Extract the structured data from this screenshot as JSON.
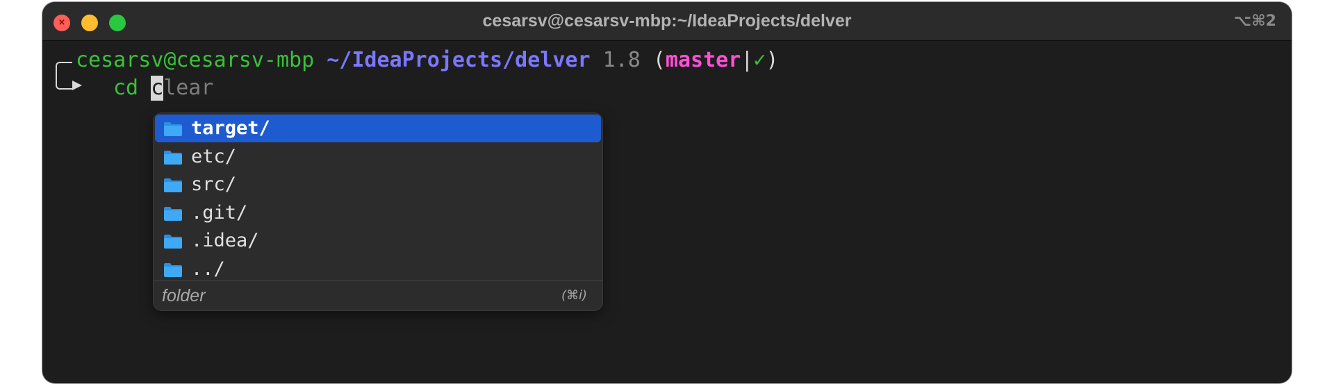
{
  "window": {
    "title": "cesarsv@cesarsv-mbp:~/IdeaProjects/delver",
    "shortcut": "⌥⌘2",
    "close_symbol": "×"
  },
  "prompt": {
    "user": "cesarsv",
    "at": "@",
    "host": "cesarsv-mbp",
    "path": "~/IdeaProjects/delver",
    "version": "1.8",
    "open_paren": "(",
    "branch": "master",
    "separator": "|",
    "status": "✓",
    "close_paren": ")"
  },
  "command": {
    "typed": "cd ",
    "cursor_char": "c",
    "suggestion_rest": "lear"
  },
  "autocomplete": {
    "items": [
      {
        "label": "target/",
        "icon": "folder-icon",
        "selected": true
      },
      {
        "label": "etc/",
        "icon": "folder-icon",
        "selected": false
      },
      {
        "label": "src/",
        "icon": "folder-icon",
        "selected": false
      },
      {
        "label": ".git/",
        "icon": "folder-icon",
        "selected": false
      },
      {
        "label": ".idea/",
        "icon": "folder-icon",
        "selected": false
      },
      {
        "label": "../",
        "icon": "folder-icon",
        "selected": false
      }
    ],
    "footer_description": "folder",
    "footer_hint": "(⌘i)"
  },
  "colors": {
    "selection": "#1f5bd0",
    "prompt_green": "#3ac13a",
    "path_purple": "#7b78ff",
    "branch_pink": "#ff4fd8",
    "folder_blue": "#3fa9f5"
  }
}
